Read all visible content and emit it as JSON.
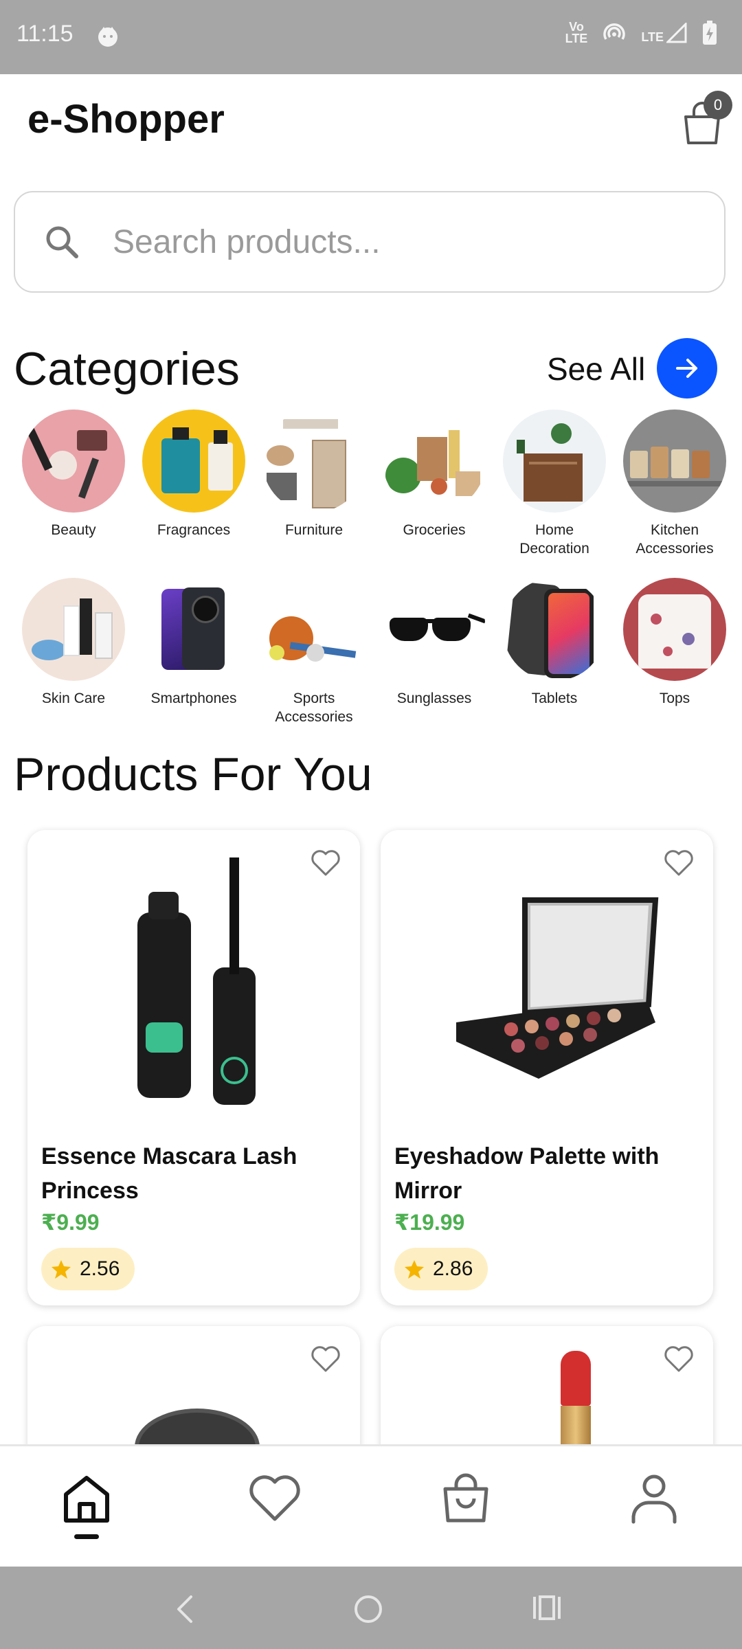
{
  "status_bar": {
    "time": "11:15",
    "icons": [
      "cat-notification-icon",
      "volte-icon",
      "hotspot-icon",
      "lte-signal-icon",
      "battery-charging-icon"
    ],
    "volte_text": "Vo\nLTE",
    "lte_text": "LTE"
  },
  "header": {
    "title": "e-Shopper",
    "cart_count": "0"
  },
  "search": {
    "placeholder": "Search products..."
  },
  "categories": {
    "title": "Categories",
    "see_all": "See All",
    "items": [
      {
        "label": "Beauty",
        "color": "#e8a2a8"
      },
      {
        "label": "Fragrances",
        "color": "#f6c21a"
      },
      {
        "label": "Furniture",
        "color": "#ffffff"
      },
      {
        "label": "Groceries",
        "color": "#ffffff"
      },
      {
        "label": "Home Decoration",
        "color": "#eef2f4"
      },
      {
        "label": "Kitchen Accessories",
        "color": "#8a8a8a"
      },
      {
        "label": "Skin Care",
        "color": "#f2e3da"
      },
      {
        "label": "Smartphones",
        "color": "#ffffff"
      },
      {
        "label": "Sports Accessories",
        "color": "#ffffff"
      },
      {
        "label": "Sunglasses",
        "color": "#ffffff"
      },
      {
        "label": "Tablets",
        "color": "#ffffff"
      },
      {
        "label": "Tops",
        "color": "#b54a4e"
      }
    ]
  },
  "products": {
    "title": "Products For You",
    "items": [
      {
        "name": "Essence Mascara Lash Princess",
        "price": "₹9.99",
        "rating": "2.56"
      },
      {
        "name": "Eyeshadow Palette with Mirror",
        "price": "₹19.99",
        "rating": "2.86"
      }
    ]
  },
  "colors": {
    "accent": "#0a55ff",
    "price": "#4caf50",
    "rating_bg": "#fdefc3",
    "star": "#f5b400",
    "status_bar": "#a6a6a6"
  },
  "bottom_nav": [
    "home-icon",
    "heart-icon",
    "bag-icon",
    "profile-icon"
  ],
  "system_nav": [
    "back-icon",
    "home-circle-icon",
    "recents-icon"
  ]
}
